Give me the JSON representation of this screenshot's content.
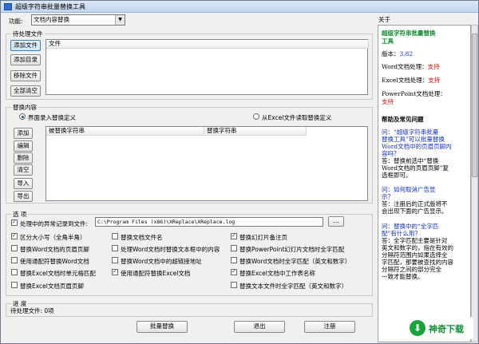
{
  "window": {
    "title": "超级字符串批量替换工具"
  },
  "function": {
    "label": "功能:",
    "selected": "文档内容替换"
  },
  "files": {
    "legend": "待处理文件",
    "buttons": [
      "添加文件",
      "添加目录",
      "移除文件",
      "全部清空"
    ],
    "column": "文件"
  },
  "replace": {
    "legend": "替换内容",
    "radio_manual": "界面录入替换定义",
    "radio_excel": "从Excel文件读取替换定义",
    "buttons": [
      "添加",
      "编辑",
      "删除",
      "清空",
      "导入",
      "导出"
    ],
    "col_find": "被替换字符串",
    "col_replace": "替换字符串"
  },
  "options": {
    "legend": "选  项",
    "error_log_label": "处理中的异常记录到文件:",
    "error_log_path": "C:\\Program Files (x86)\\XReplace\\XReplace.log",
    "browse": "...",
    "rows": [
      [
        "区分大小写（全角半角）",
        "替换文档文件名",
        "替换幻灯片备注页"
      ],
      [
        "替换Word文档的页眉页脚",
        "处理Word文档时替换文本框中的内容",
        "替换PowerPoint幻灯片文档时全字匹配"
      ],
      [
        "使用通配符替换Word文档",
        "替换Word文档中的超链接地址",
        "替换Word文档时全字匹配（英文和数字）"
      ],
      [
        "替换Excel文档时单元格匹配",
        "使用通配符替换Excel文档",
        "替换Excel文档中工作表名称"
      ],
      [
        "替换Excel文档页眉页脚",
        "",
        "替换文本文件时全字匹配（英文和数字）"
      ]
    ],
    "checked": [
      [
        true,
        false,
        true
      ],
      [
        false,
        false,
        false
      ],
      [
        false,
        false,
        false
      ],
      [
        false,
        true,
        true
      ],
      [
        false,
        false,
        false
      ]
    ]
  },
  "progress": {
    "legend": "进  度",
    "status": "待处理文件: 0项"
  },
  "footer": {
    "run": "批量替换",
    "exit": "退出",
    "register": "注册"
  },
  "about": {
    "header": "关于",
    "app_name_line1": "超级字符串批量替换",
    "app_name_line2": "工具",
    "version_label": "版本：",
    "version_value": "3.82",
    "word_label": "Word文档处理：",
    "excel_label": "Excel文档处理：",
    "ppt_label": "PowerPoint文档处理：",
    "supported": "支持",
    "help_title": "帮助及常见问题",
    "q1": [
      "问：“超级字符串批量",
      "替换工具”可以批量替换",
      "Word文档中的页眉页脚内",
      "容吗？"
    ],
    "a1": [
      "答：替换前选中“替换",
      "Word文档的页眉页脚”复",
      "选框即可。"
    ],
    "q2": [
      "问：如何取消广告显",
      "示？"
    ],
    "a2": [
      "答：注册后的正式版将不",
      "会出现下面的广告显示。"
    ],
    "q3": [
      "问：替换中的“全字匹",
      "配”有什么用？"
    ],
    "a3": [
      "答：全字匹配主要是针对",
      "英文和数字的，指在有效的",
      "分隔符范围内如果选择全",
      "字匹配，那要被查找的内容",
      "分隔符之间的部分完全",
      "一致才能替换。"
    ]
  },
  "watermark": {
    "name": "神奇下载"
  }
}
